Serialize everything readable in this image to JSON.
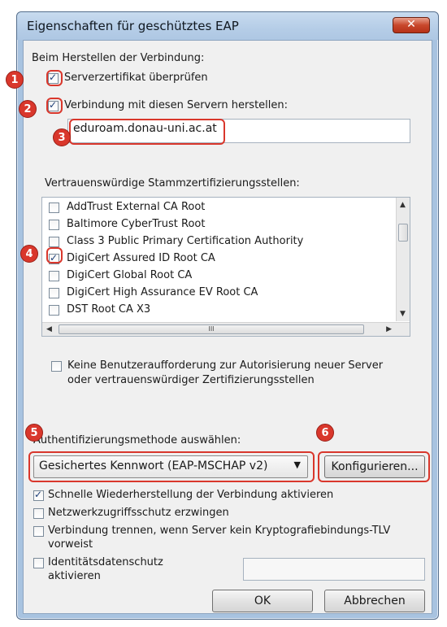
{
  "window": {
    "title": "Eigenschaften für geschütztes EAP",
    "close_label": "✕"
  },
  "connect_section": {
    "heading": "Beim Herstellen der Verbindung:",
    "verify_cert_label": "Serverzertifikat überprüfen",
    "verify_cert_checked": true,
    "connect_servers_label": "Verbindung mit diesen Servern herstellen:",
    "connect_servers_checked": true,
    "server_value": "eduroam.donau-uni.ac.at"
  },
  "trusted_ca": {
    "heading": "Vertrauenswürdige Stammzertifizierungsstellen:",
    "items": [
      {
        "label": "AddTrust External CA Root",
        "checked": false
      },
      {
        "label": "Baltimore CyberTrust Root",
        "checked": false
      },
      {
        "label": "Class 3 Public Primary Certification Authority",
        "checked": false
      },
      {
        "label": "DigiCert Assured ID Root CA",
        "checked": true
      },
      {
        "label": "DigiCert Global Root CA",
        "checked": false
      },
      {
        "label": "DigiCert High Assurance EV Root CA",
        "checked": false
      },
      {
        "label": "DST Root CA X3",
        "checked": false
      }
    ],
    "hscroll_thumb_label": "III"
  },
  "no_prompt": {
    "label_line1": "Keine Benutzeraufforderung zur Autorisierung neuer Server",
    "label_line2": "oder vertrauenswürdiger Zertifizierungsstellen",
    "checked": false
  },
  "auth_method": {
    "heading": "Authentifizierungsmethode auswählen:",
    "selected": "Gesichertes Kennwort (EAP-MSCHAP v2)",
    "configure_label": "Konfigurieren..."
  },
  "options": {
    "fast_reconnect_label": "Schnelle Wiederherstellung der Verbindung aktivieren",
    "fast_reconnect_checked": true,
    "nap_label": "Netzwerkzugriffsschutz erzwingen",
    "nap_checked": false,
    "disconnect_label_line1": "Verbindung trennen, wenn Server kein Kryptografiebindungs-TLV",
    "disconnect_label_line2": "vorweist",
    "disconnect_checked": false,
    "identity_label_line1": "Identitätsdatenschutz",
    "identity_label_line2": "aktivieren",
    "identity_checked": false,
    "identity_value": ""
  },
  "buttons": {
    "ok_label": "OK",
    "cancel_label": "Abbrechen"
  },
  "callouts": [
    "1",
    "2",
    "3",
    "4",
    "5",
    "6"
  ],
  "colors": {
    "callout_red": "#d9372c",
    "window_frame": "#a8c3e0",
    "client_bg": "#f0f0f0"
  }
}
